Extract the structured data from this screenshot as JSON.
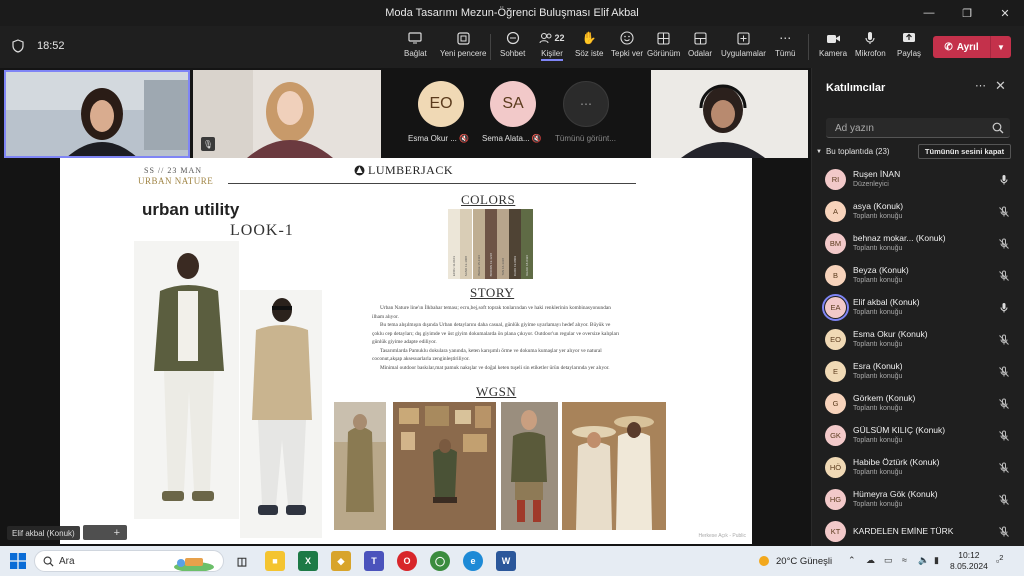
{
  "window": {
    "title": "Moda Tasarımı Mezun-Öğrenci Buluşması Elif Akbal"
  },
  "toolbar": {
    "timer": "18:52",
    "buttons": [
      {
        "label": "Bağlat",
        "icon": "screen-share-icon"
      },
      {
        "label": "Yeni pencere",
        "icon": "new-window-icon"
      },
      {
        "label": "Sohbet",
        "icon": "chat-icon"
      },
      {
        "label": "Kişiler",
        "icon": "people-icon",
        "count": "22",
        "active": true
      },
      {
        "label": "Söz iste",
        "icon": "raise-hand-icon"
      },
      {
        "label": "Tepki ver",
        "icon": "react-icon"
      },
      {
        "label": "Görünüm",
        "icon": "view-icon"
      },
      {
        "label": "Odalar",
        "icon": "rooms-icon"
      },
      {
        "label": "Uygulamalar",
        "icon": "apps-icon"
      },
      {
        "label": "Tümü",
        "icon": "more-icon"
      },
      {
        "label": "Kamera",
        "icon": "camera-icon"
      },
      {
        "label": "Mikrofon",
        "icon": "microphone-icon"
      },
      {
        "label": "Paylaş",
        "icon": "share-icon"
      }
    ],
    "leave_label": "Ayrıl"
  },
  "stage": {
    "avatars": [
      {
        "initials": "EO",
        "name": "Esma Okur ...",
        "color": "#f0d9b5"
      },
      {
        "initials": "SA",
        "name": "Sema Alata...",
        "color": "#f2c9c9"
      }
    ],
    "more_tile_label": "Tümünü görünt...",
    "self_label": "Elif akbal (Konuk)"
  },
  "slide": {
    "season": "SS // 23 MAN",
    "collection": "URBAN NATURE",
    "brand": "LUMBERJACK",
    "headline": "urban utility",
    "look": "LOOK-1",
    "colors_title": "COLORS",
    "story_title": "STORY",
    "wgsn_title": "WGSN",
    "story_paragraphs": [
      "Urban Nature line'ın İlkbahar teması; ecru,bej,soft toprak tonlarından ve haki renklerinin kombinasyonundan ilham alıyor.",
      "Bu tema alışılmışın dışında Urban detaylarını daha casual, günlük giyime uyarlamayı hedef alıyor. Büyük ve çoklu cep detayları; dış giyimde ve üst giyim dokumalarda ön plana çıkıyor. Outdoor'un regular ve oversize kalıpları günlük giyime adapte ediliyor.",
      "Tasarımlarda Pamuklu dokulara yanında, keten karışımlı örme ve dokuma kumaşlar yer alıyor ve natural coconut,akşap aksesuarlarla zenginleştiriliyor.",
      "Minimal outdoor baskılar,mat pamuk nakışlar ve doğal keten tuşeli sin etiketler ürün detaylarında yer alıyor."
    ],
    "swatches": [
      {
        "color": "#ece6d8",
        "code": "ECRU 11-0103"
      },
      {
        "color": "#d9cdb6",
        "code": "SAND 13-1008"
      },
      {
        "color": "#bfae92",
        "code": "BEIGE 15-1116"
      },
      {
        "color": "#6e5446",
        "code": "BROWN 19-1218"
      },
      {
        "color": "#b8a58c",
        "code": "TAN 16-1318"
      },
      {
        "color": "#4f4334",
        "code": "DARK 19-0809"
      },
      {
        "color": "#5f6b45",
        "code": "KHAKI 18-0426"
      }
    ],
    "footer": "Herkese Açık - Public"
  },
  "panel": {
    "title": "Katılımcılar",
    "search_placeholder": "Ad yazın",
    "meeting_header": "Bu toplantıda (23)",
    "mute_all_label": "Tümünün sesini kapat",
    "participants": [
      {
        "initials": "RI",
        "name": "Ruşen İNAN",
        "role": "Düzenleyici",
        "color": "#f2c9c9",
        "mic": "on"
      },
      {
        "initials": "A",
        "name": "asya (Konuk)",
        "role": "Toplantı konuğu",
        "color": "#f7d3bb",
        "mic": "off"
      },
      {
        "initials": "BM",
        "name": "behnaz mokar...  (Konuk)",
        "role": "Toplantı konuğu",
        "color": "#f2c9c9",
        "mic": "off"
      },
      {
        "initials": "B",
        "name": "Beyza (Konuk)",
        "role": "Toplantı konuğu",
        "color": "#f7d3bb",
        "mic": "off"
      },
      {
        "initials": "EA",
        "name": "Elif akbal (Konuk)",
        "role": "Toplantı konuğu",
        "color": "#f2c9c9",
        "mic": "on",
        "speaking": true
      },
      {
        "initials": "EO",
        "name": "Esma Okur (Konuk)",
        "role": "Toplantı konuğu",
        "color": "#f0d9b5",
        "mic": "off"
      },
      {
        "initials": "E",
        "name": "Esra (Konuk)",
        "role": "Toplantı konuğu",
        "color": "#f0d9b5",
        "mic": "off"
      },
      {
        "initials": "G",
        "name": "Görkem (Konuk)",
        "role": "Toplantı konuğu",
        "color": "#f7d3bb",
        "mic": "off"
      },
      {
        "initials": "GK",
        "name": "GÜLSÜM KILIÇ (Konuk)",
        "role": "Toplantı konuğu",
        "color": "#f2c9c9",
        "mic": "off"
      },
      {
        "initials": "HÖ",
        "name": "Habibe Öztürk (Konuk)",
        "role": "Toplantı konuğu",
        "color": "#f0d9b5",
        "mic": "off"
      },
      {
        "initials": "HG",
        "name": "Hümeyra Gök (Konuk)",
        "role": "Toplantı konuğu",
        "color": "#f2c9c9",
        "mic": "off"
      },
      {
        "initials": "KT",
        "name": "KARDELEN EMİNE TÜRK",
        "role": "",
        "color": "#f2c9c9",
        "mic": "off"
      }
    ]
  },
  "taskbar": {
    "search_label": "Ara",
    "weather": "20°C  Güneşli",
    "time": "10:12",
    "date": "8.05.2024",
    "notifications": "2"
  }
}
